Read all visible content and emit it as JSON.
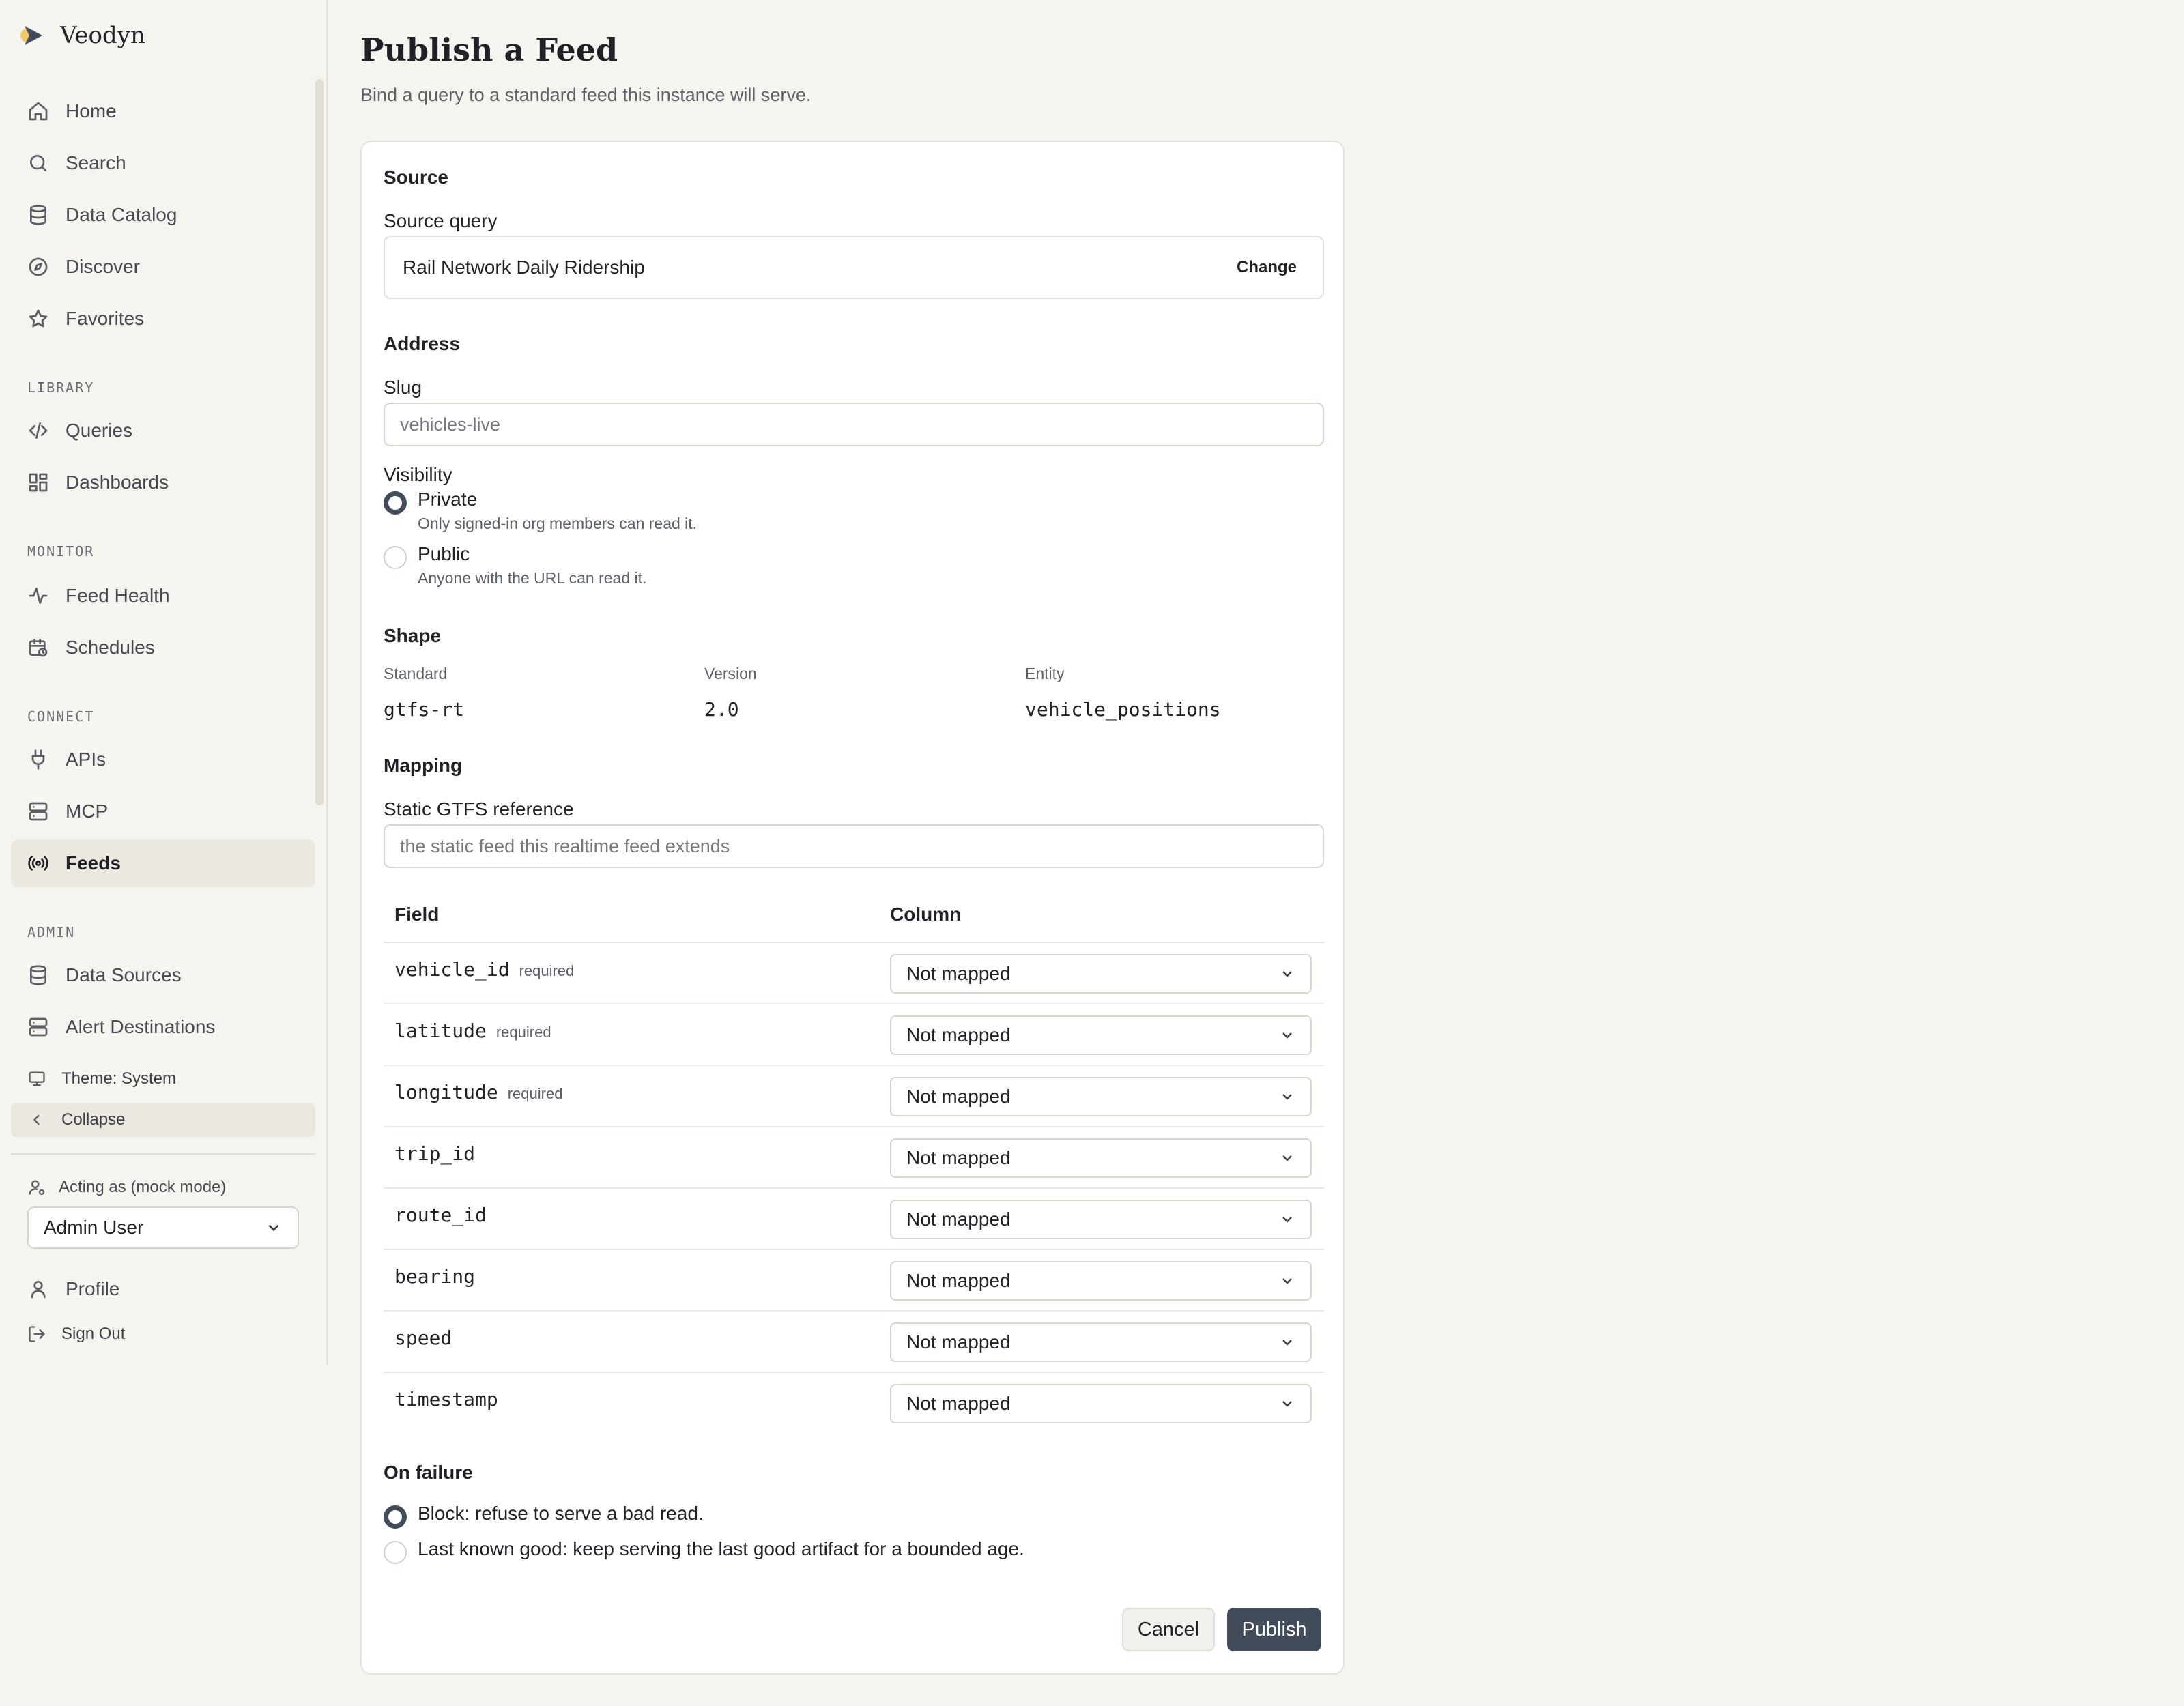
{
  "brand": {
    "name": "Veodyn"
  },
  "sidebar": {
    "primary": [
      {
        "label": "Home",
        "icon": "home-icon"
      },
      {
        "label": "Search",
        "icon": "search-icon"
      },
      {
        "label": "Data Catalog",
        "icon": "database-icon"
      },
      {
        "label": "Discover",
        "icon": "compass-icon"
      },
      {
        "label": "Favorites",
        "icon": "star-icon"
      }
    ],
    "sections": [
      {
        "label": "LIBRARY",
        "items": [
          {
            "label": "Queries",
            "icon": "code-icon"
          },
          {
            "label": "Dashboards",
            "icon": "dashboard-icon"
          }
        ]
      },
      {
        "label": "MONITOR",
        "items": [
          {
            "label": "Feed Health",
            "icon": "activity-icon"
          },
          {
            "label": "Schedules",
            "icon": "calendar-clock-icon"
          }
        ]
      },
      {
        "label": "CONNECT",
        "items": [
          {
            "label": "APIs",
            "icon": "plug-icon"
          },
          {
            "label": "MCP",
            "icon": "server-icon"
          },
          {
            "label": "Feeds",
            "icon": "broadcast-icon",
            "active": true
          }
        ]
      },
      {
        "label": "ADMIN",
        "items": [
          {
            "label": "Data Sources",
            "icon": "database-icon"
          },
          {
            "label": "Alert Destinations",
            "icon": "server-icon"
          }
        ]
      }
    ],
    "theme_label": "Theme: System",
    "collapse_label": "Collapse",
    "acting_as_label": "Acting as (mock mode)",
    "acting_user": "Admin User",
    "profile_label": "Profile",
    "signout_label": "Sign Out"
  },
  "page": {
    "title": "Publish a Feed",
    "subtitle": "Bind a query to a standard feed this instance will serve."
  },
  "form": {
    "source": {
      "heading": "Source",
      "label": "Source query",
      "value": "Rail Network Daily Ridership",
      "change_label": "Change"
    },
    "address": {
      "heading": "Address",
      "slug_label": "Slug",
      "slug_placeholder": "vehicles-live"
    },
    "visibility": {
      "label": "Visibility",
      "options": [
        {
          "title": "Private",
          "desc": "Only signed-in org members can read it.",
          "checked": true
        },
        {
          "title": "Public",
          "desc": "Anyone with the URL can read it.",
          "checked": false
        }
      ]
    },
    "shape": {
      "heading": "Shape",
      "standard_label": "Standard",
      "standard_value": "gtfs-rt",
      "version_label": "Version",
      "version_value": "2.0",
      "entity_label": "Entity",
      "entity_value": "vehicle_positions"
    },
    "mapping": {
      "heading": "Mapping",
      "static_label": "Static GTFS reference",
      "static_placeholder": "the static feed this realtime feed extends",
      "col_field": "Field",
      "col_column": "Column",
      "required_tag": "required",
      "rows": [
        {
          "field": "vehicle_id",
          "required": true,
          "value": "Not mapped"
        },
        {
          "field": "latitude",
          "required": true,
          "value": "Not mapped"
        },
        {
          "field": "longitude",
          "required": true,
          "value": "Not mapped"
        },
        {
          "field": "trip_id",
          "required": false,
          "value": "Not mapped"
        },
        {
          "field": "route_id",
          "required": false,
          "value": "Not mapped"
        },
        {
          "field": "bearing",
          "required": false,
          "value": "Not mapped"
        },
        {
          "field": "speed",
          "required": false,
          "value": "Not mapped"
        },
        {
          "field": "timestamp",
          "required": false,
          "value": "Not mapped"
        }
      ]
    },
    "failure": {
      "heading": "On failure",
      "options": [
        {
          "title": "Block: refuse to serve a bad read.",
          "checked": true
        },
        {
          "title": "Last known good: keep serving the last good artifact for a bounded age.",
          "checked": false
        }
      ]
    },
    "cancel_label": "Cancel",
    "publish_label": "Publish"
  },
  "colors": {
    "primary": "#414b5a",
    "background": "#f6f4ef",
    "active_nav": "#ece7df"
  }
}
